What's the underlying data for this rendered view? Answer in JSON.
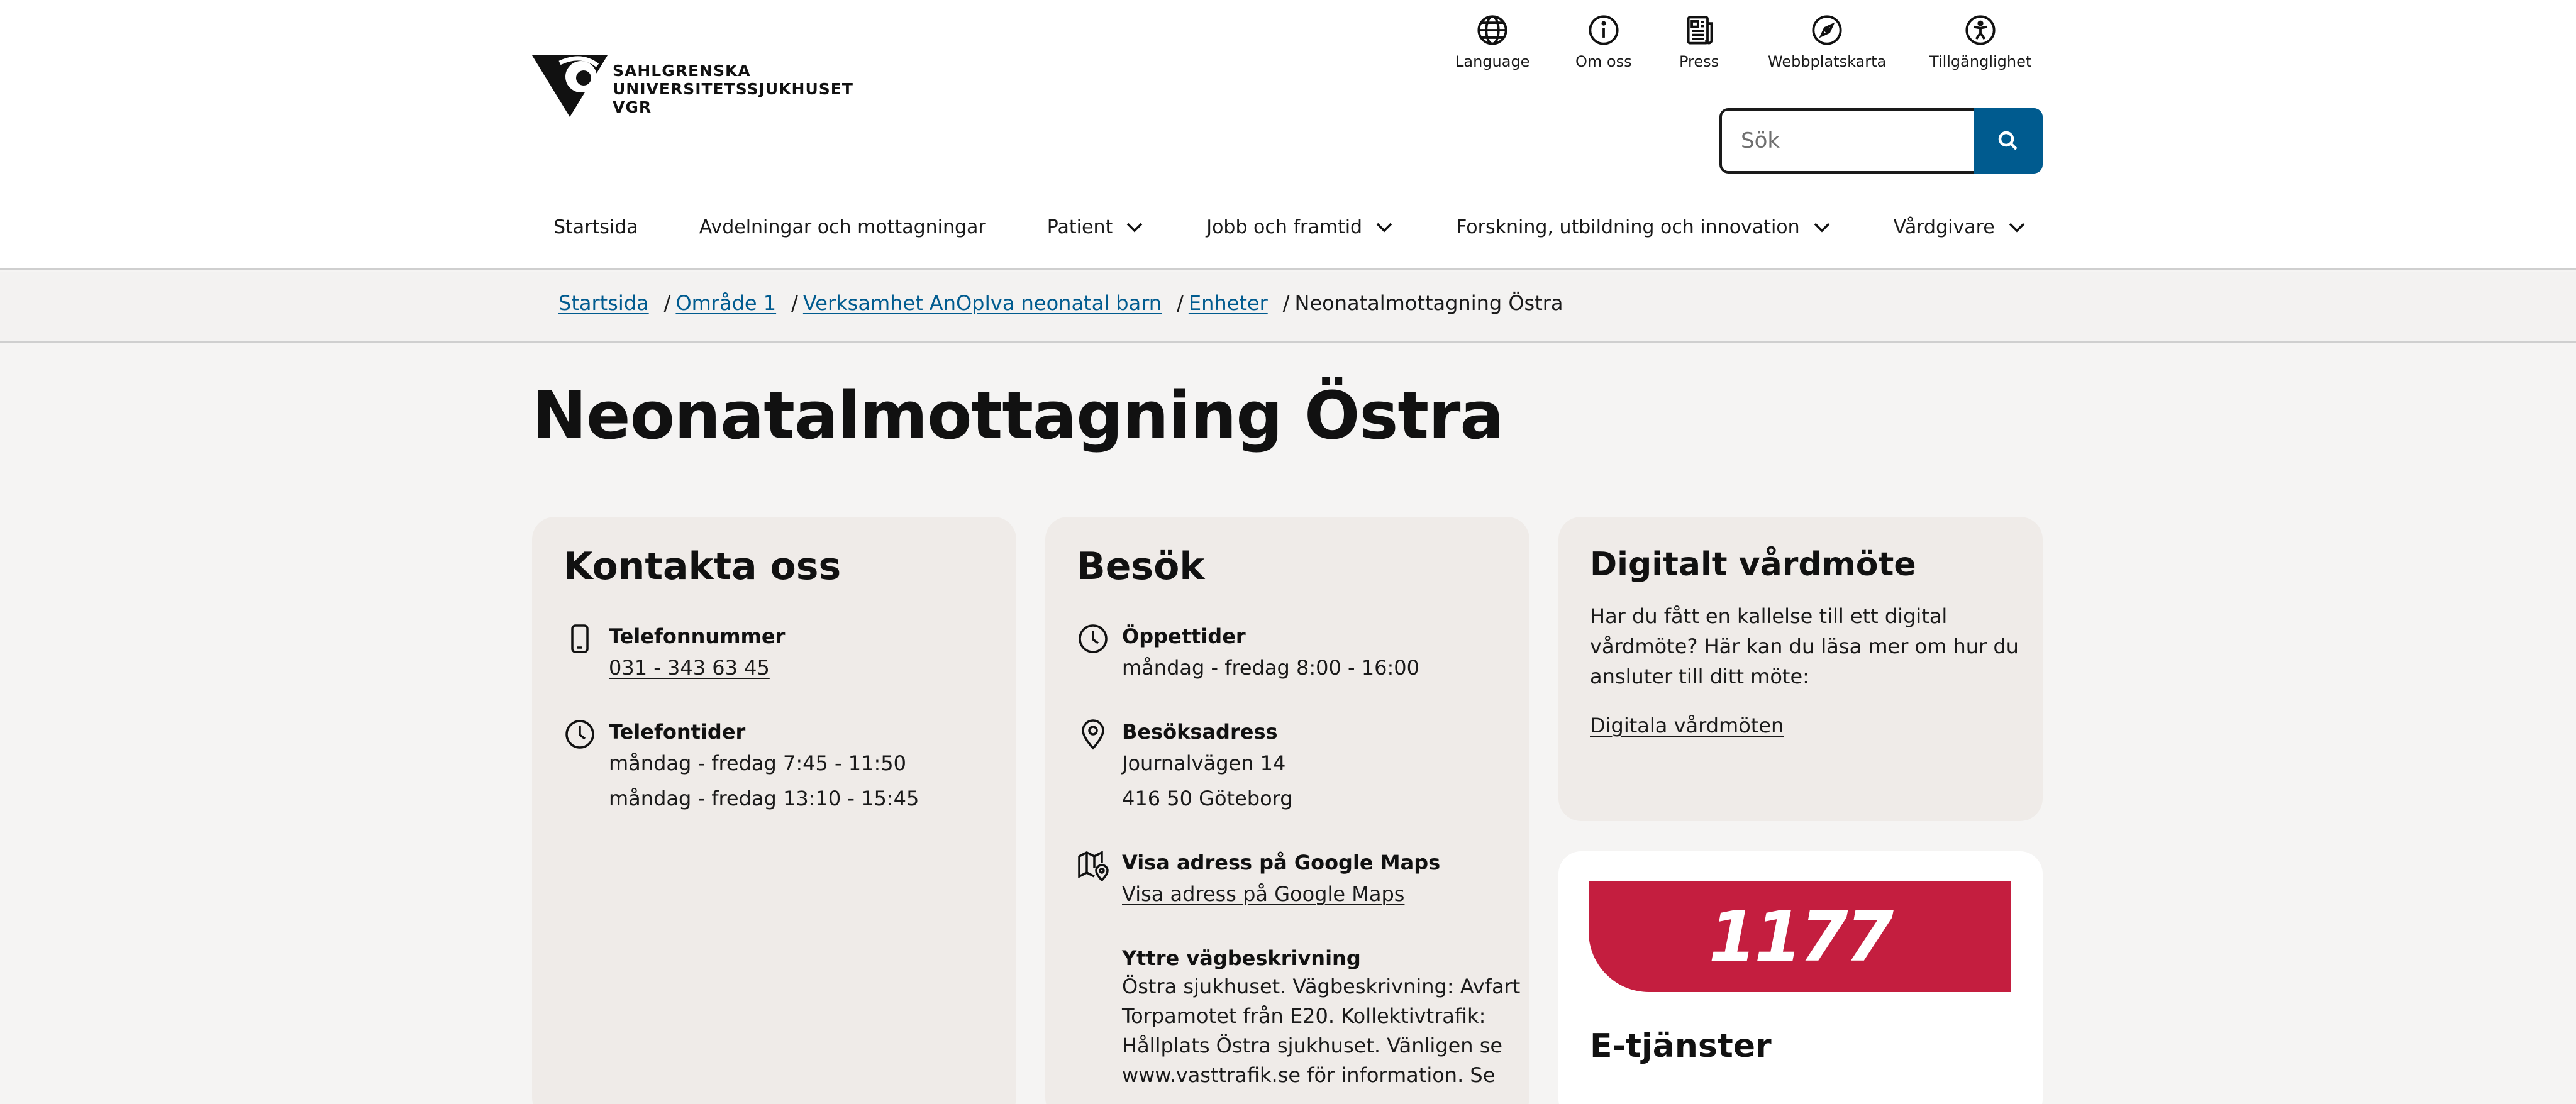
{
  "header": {
    "logo_lines": [
      "SAHLGRENSKA",
      "UNIVERSITETSSJUKHUSET",
      "VGR"
    ],
    "utility": [
      {
        "label": "Language",
        "icon": "globe-icon"
      },
      {
        "label": "Om oss",
        "icon": "info-icon"
      },
      {
        "label": "Press",
        "icon": "newspaper-icon"
      },
      {
        "label": "Webbplatskarta",
        "icon": "compass-icon"
      },
      {
        "label": "Tillgänglighet",
        "icon": "accessibility-icon"
      }
    ],
    "search": {
      "placeholder": "Sök",
      "value": "",
      "button_icon": "search-icon"
    }
  },
  "nav": [
    {
      "label": "Startsida",
      "has_dropdown": false
    },
    {
      "label": "Avdelningar och mottagningar",
      "has_dropdown": false
    },
    {
      "label": "Patient",
      "has_dropdown": true
    },
    {
      "label": "Jobb och framtid",
      "has_dropdown": true
    },
    {
      "label": "Forskning, utbildning och innovation",
      "has_dropdown": true
    },
    {
      "label": "Vårdgivare",
      "has_dropdown": true
    }
  ],
  "breadcrumb": {
    "links": [
      "Startsida",
      "Område 1",
      "Verksamhet AnOpIva neonatal barn",
      "Enheter"
    ],
    "separator": "/",
    "current": "Neonatalmottagning Östra"
  },
  "page": {
    "title": "Neonatalmottagning Östra"
  },
  "contact": {
    "heading": "Kontakta oss",
    "phone": {
      "title": "Telefonnummer",
      "number": "031 - 343 63 45",
      "icon": "mobile-phone-icon"
    },
    "phone_times": {
      "title": "Telefontider",
      "lines": [
        "måndag - fredag 7:45 - 11:50",
        "måndag - fredag 13:10 - 15:45"
      ],
      "icon": "clock-icon"
    }
  },
  "visit": {
    "heading": "Besök",
    "hours": {
      "title": "Öppettider",
      "line": "måndag - fredag 8:00 - 16:00",
      "icon": "clock-icon"
    },
    "address": {
      "title": "Besöksadress",
      "lines": [
        "Journalvägen 14",
        "416 50 Göteborg"
      ],
      "icon": "map-pin-icon"
    },
    "maps": {
      "title": "Visa adress på Google Maps",
      "link": "Visa adress på Google Maps",
      "icon": "map-icon"
    },
    "directions": {
      "title": "Yttre vägbeskrivning",
      "lines": [
        "Östra sjukhuset. Vägbeskrivning: Avfart",
        "Torpamotet från E20. Kollektivtrafik:",
        "Hållplats Östra sjukhuset. Vänligen se",
        "www.vasttrafik.se för information. Se"
      ]
    }
  },
  "digital": {
    "heading": "Digitalt vårdmöte",
    "lines": [
      "Har du fått en kallelse till ett digital",
      "vårdmöte? Här kan du läsa mer om hur du",
      "ansluter till ditt möte:"
    ],
    "link": "Digitala vårdmöten"
  },
  "eservices": {
    "logo_text": "1177",
    "heading": "E-tjänster",
    "brand_color": "#c41e3f"
  },
  "colors": {
    "link": "#005b8f",
    "search_button": "#005b8f",
    "card_bg": "#efebe8",
    "page_bg": "#f5f4f3"
  }
}
